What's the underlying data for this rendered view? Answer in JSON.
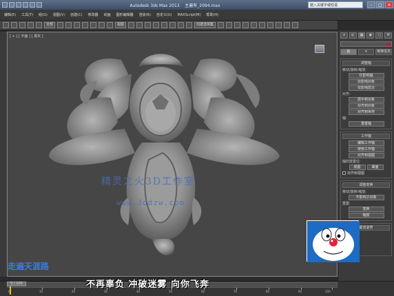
{
  "titlebar": {
    "title": "Autodesk 3ds Max  2013",
    "file": "主遍有_2094.max",
    "help_search": "键入关键字或短语"
  },
  "menubar": {
    "items": [
      "编辑(E)",
      "工具(T)",
      "组(G)",
      "视图(V)",
      "创建(C)",
      "修改器",
      "动画",
      "图形编辑器",
      "渲染(R)",
      "自定义(U)",
      "MAXScript(M)",
      "帮助(H)"
    ]
  },
  "toolbar": {
    "selection_filter": "全部",
    "ref_coord": "视图",
    "selection_set": "创建选择集"
  },
  "viewport": {
    "label": "[ + ] [ 平面 ] [ 真实 ]"
  },
  "watermark": {
    "line1": "精灵之火3D工作室",
    "line2": "www.3ddzw.com"
  },
  "overlay_text": {
    "left": "走遍天涯路",
    "caption": "不再辜负 冲破迷雾 向你飞奔"
  },
  "command_panel": {
    "tabs": [
      "+",
      "◎",
      "▦",
      "◉",
      "▢",
      "⚒"
    ],
    "subtabs": [
      "轴",
      "✕",
      "链接信息"
    ],
    "adjust_pivot": {
      "title": "调整轴",
      "move_label": "移动/旋转/缩放:",
      "buttons": [
        "仅影响轴",
        "仅影响对象",
        "仅影响层次"
      ],
      "align_label": "对齐:",
      "align_buttons": [
        "居中到对象",
        "对齐到对象",
        "对齐到世界"
      ],
      "pivot_label": "轴:",
      "reset_button": "重置轴"
    },
    "working_pivot": {
      "title": "工作轴",
      "buttons": [
        "编辑工作轴",
        "使用工作轴",
        "对齐到视图"
      ],
      "placement_label": "轴的放置位:",
      "placement_buttons": [
        "视图",
        "曲面"
      ],
      "align_view": "对齐到视图"
    },
    "adjust_transform": {
      "title": "调整变换",
      "move_label": "移动/旋转/缩放:",
      "button": "不影响子对象",
      "reset_label": "重置:",
      "reset_buttons": [
        "变换",
        "缩放"
      ]
    },
    "skew": {
      "title": "蒙皮姿势",
      "enable_label": "启用:",
      "checks": [
        "位置",
        "旋转",
        "缩放"
      ]
    }
  },
  "timeline": {
    "frame": "0 / 100",
    "ticks": [
      "0",
      "10",
      "20",
      "30",
      "40",
      "50",
      "60",
      "70",
      "80",
      "90",
      "100"
    ]
  }
}
